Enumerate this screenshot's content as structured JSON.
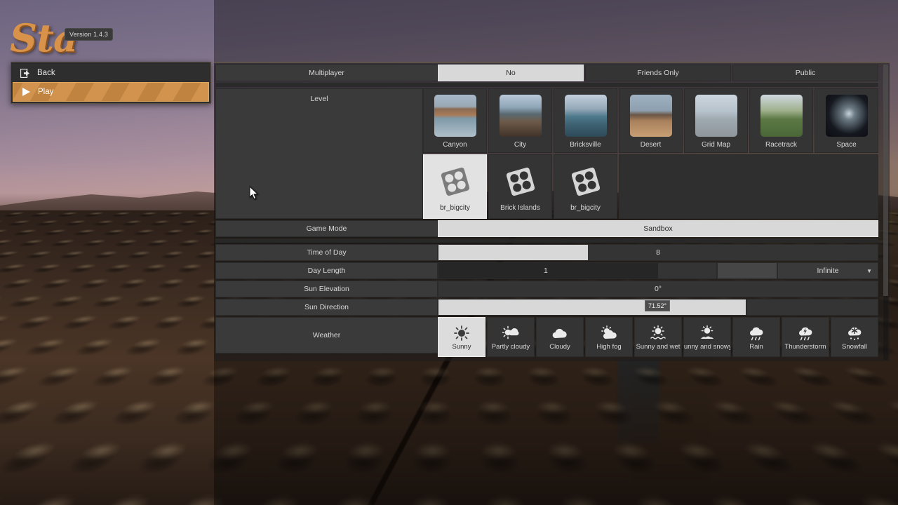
{
  "branding": {
    "title": "Sta",
    "version": "Version 1.4.3"
  },
  "left_menu": {
    "items": [
      {
        "label": "Back",
        "icon": "back-arrow-icon"
      },
      {
        "label": "Play",
        "icon": "play-triangle-icon"
      }
    ]
  },
  "settings": {
    "multiplayer": {
      "label": "Multiplayer",
      "options": [
        "No",
        "Friends Only",
        "Public"
      ],
      "selected": "No"
    },
    "level": {
      "label": "Level",
      "row1": [
        {
          "name": "Canyon",
          "thumb": "canyon"
        },
        {
          "name": "City",
          "thumb": "city"
        },
        {
          "name": "Bricksville",
          "thumb": "bricksville"
        },
        {
          "name": "Desert",
          "thumb": "desert"
        },
        {
          "name": "Grid Map",
          "thumb": "gridmap"
        },
        {
          "name": "Racetrack",
          "thumb": "racetrack"
        },
        {
          "name": "Space",
          "thumb": "space"
        }
      ],
      "row2": [
        {
          "name": "br_bigcity",
          "thumb": "brick"
        },
        {
          "name": "Brick Islands",
          "thumb": "brick"
        },
        {
          "name": "br_bigcity",
          "thumb": "brick"
        }
      ],
      "selected": "br_bigcity"
    },
    "game_mode": {
      "label": "Game Mode",
      "value": "Sandbox"
    },
    "time_of_day": {
      "label": "Time of Day",
      "value": "8",
      "fill_percent": 34
    },
    "day_length": {
      "label": "Day Length",
      "value": "1",
      "fill_percent": 49,
      "dropdown": "Infinite"
    },
    "sun_elevation": {
      "label": "Sun Elevation",
      "value": "0°",
      "fill_percent": 0
    },
    "sun_direction": {
      "label": "Sun Direction",
      "value": "71.52°",
      "fill_percent": 71.5,
      "tooltip": "71.52°"
    },
    "weather": {
      "label": "Weather",
      "options": [
        {
          "name": "Sunny",
          "icon": "sun-icon"
        },
        {
          "name": "Partly cloudy",
          "icon": "sun-cloud-icon"
        },
        {
          "name": "Cloudy",
          "icon": "cloud-icon"
        },
        {
          "name": "High fog",
          "icon": "sun-behind-cloud-icon"
        },
        {
          "name": "Sunny and wet",
          "icon": "sun-waves-icon"
        },
        {
          "name": "Sunny and snowy",
          "icon": "sun-snow-icon"
        },
        {
          "name": "Rain",
          "icon": "rain-cloud-icon"
        },
        {
          "name": "Thunderstorm",
          "icon": "thunder-cloud-icon"
        },
        {
          "name": "Snowfall",
          "icon": "snow-cloud-icon"
        }
      ],
      "selected": "Sunny"
    }
  }
}
